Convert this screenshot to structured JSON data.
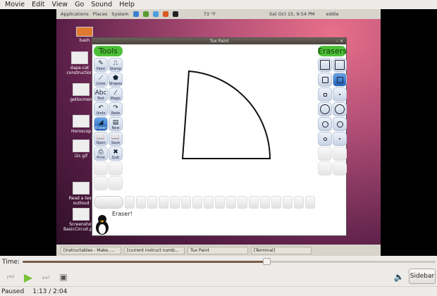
{
  "menu": [
    "Movie",
    "Edit",
    "View",
    "Go",
    "Sound",
    "Help"
  ],
  "desktop": {
    "panel": {
      "applications": "Applications",
      "places": "Places",
      "system": "System",
      "weather": "73 °F",
      "clock": "Sat Oct 15,  9:54 PM",
      "user": "eddie"
    },
    "icons": [
      "bash",
      "dapa-cat construction",
      "gellocmen",
      "Horoscop",
      "i2c.gif",
      "Read a text outloud",
      "Screenshot BasicCircuit.pdf.png"
    ],
    "taskbar": [
      "[Instructables - Make, ...",
      "[current instruct numb...",
      "Tux Paint",
      "[Terminal]"
    ]
  },
  "tuxpaint": {
    "title": "Tux Paint",
    "tools_header": "Tools",
    "erasers_header": "Erasers",
    "tools": [
      {
        "label": "Paint",
        "icon": "brush-icon",
        "g": "✎"
      },
      {
        "label": "Stamp",
        "icon": "stamp-icon",
        "g": "⎍"
      },
      {
        "label": "Lines",
        "icon": "lines-icon",
        "g": "⟋"
      },
      {
        "label": "Shapes",
        "icon": "pentagon-icon",
        "g": "⬟"
      },
      {
        "label": "Text",
        "icon": "text-icon",
        "g": "Abc"
      },
      {
        "label": "Magic",
        "icon": "magic-wand-icon",
        "g": "⁄"
      },
      {
        "label": "Undo",
        "icon": "undo-icon",
        "g": "↶"
      },
      {
        "label": "Redo",
        "icon": "redo-icon",
        "g": "↷"
      },
      {
        "label": "Eraser",
        "icon": "eraser-icon",
        "g": "◢",
        "selected": true
      },
      {
        "label": "New",
        "icon": "new-page-icon",
        "g": "▤"
      },
      {
        "label": "Open",
        "icon": "open-book-icon",
        "g": "📖"
      },
      {
        "label": "Save",
        "icon": "save-book-icon",
        "g": "📖"
      },
      {
        "label": "Print",
        "icon": "printer-icon",
        "g": "⎙"
      },
      {
        "label": "Quit",
        "icon": "quit-icon",
        "g": "✖"
      }
    ],
    "erasers": [
      "square-large",
      "square-large",
      "square-medium",
      "square-medium",
      "square-small",
      "square-tiny",
      "circle-large",
      "circle-large",
      "circle-medium",
      "circle-medium",
      "circle-small",
      "circle-tiny"
    ],
    "selected_eraser": 3,
    "message": "Eraser!"
  },
  "player": {
    "time_label": "Time:",
    "progress": 0.59,
    "sidebar_label": "Sidebar",
    "status": "Paused",
    "time": "1:13 / 2:04"
  }
}
